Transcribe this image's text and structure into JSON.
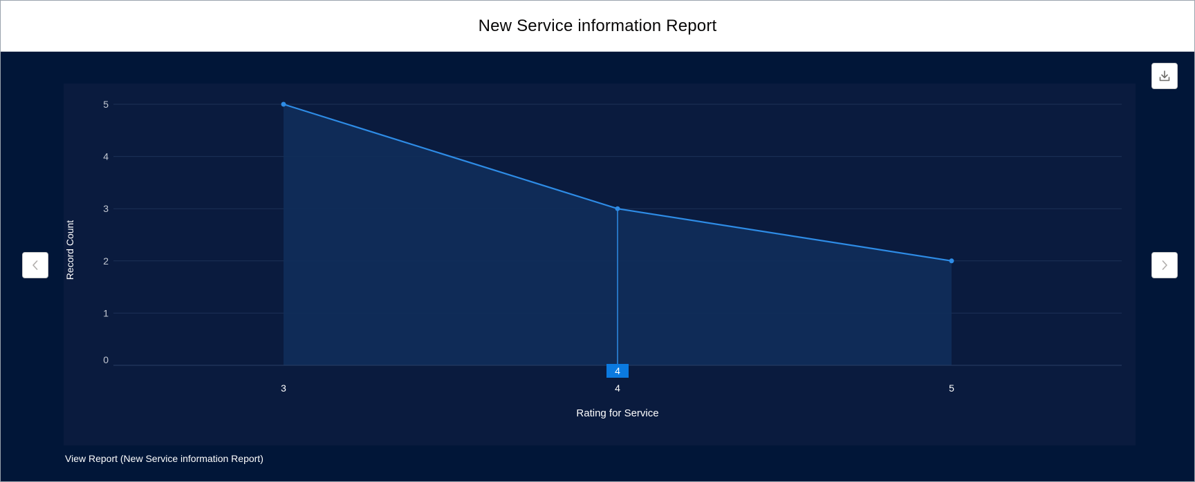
{
  "header": {
    "title": "New Service information Report"
  },
  "footer": {
    "view_report_label": "View Report (New Service information Report)"
  },
  "icons": {
    "prev": "chevron-left-icon",
    "next": "chevron-right-icon",
    "download": "download-icon"
  },
  "colors": {
    "panel_bg": "#011638",
    "plot_bg": "#0a1b3e",
    "line": "#2e8ce6",
    "area": "#0f2d5a",
    "highlight": "#0b7ae0",
    "tick_text": "#c3c8d2",
    "grid": "#1d3157"
  },
  "chart_data": {
    "type": "area",
    "x": [
      "3",
      "4",
      "5"
    ],
    "series": [
      {
        "values": [
          5,
          3,
          2
        ]
      }
    ],
    "xlabel": "Rating for Service",
    "ylabel": "Record Count",
    "ylim": [
      0,
      5
    ],
    "yticks": [
      0,
      1,
      2,
      3,
      4,
      5
    ],
    "grid": true,
    "highlight": {
      "x": "4",
      "label": "4"
    }
  }
}
